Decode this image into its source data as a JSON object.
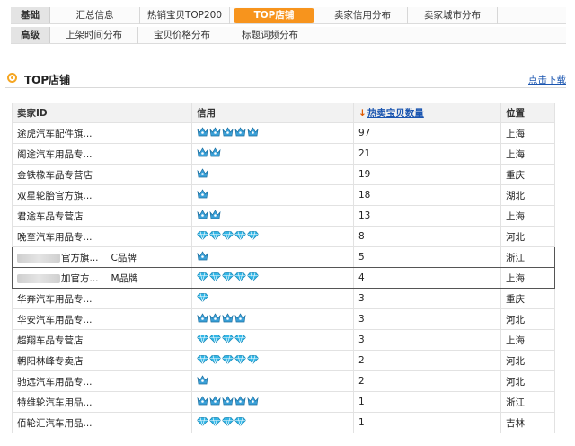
{
  "nav": {
    "row1": {
      "category": "基础",
      "tabs": [
        "汇总信息",
        "热销宝贝TOP200",
        "TOP店铺",
        "卖家信用分布",
        "卖家城市分布"
      ],
      "active_index": 2
    },
    "row2": {
      "category": "高级",
      "tabs": [
        "上架时间分布",
        "宝贝价格分布",
        "标题词频分布"
      ]
    }
  },
  "section": {
    "title": "TOP店铺",
    "download_label": "点击下载"
  },
  "table": {
    "headers": [
      "卖家ID",
      "信用",
      "热卖宝贝数量",
      "位置"
    ],
    "sort_arrow": "↓",
    "rows": [
      {
        "seller": "途虎汽车配件旗...",
        "brand": "",
        "credit_icon": "crown-icon",
        "credit_count": 5,
        "count": "97",
        "location": "上海"
      },
      {
        "seller": "阁途汽车用品专...",
        "brand": "",
        "credit_icon": "crown-icon",
        "credit_count": 2,
        "count": "21",
        "location": "上海"
      },
      {
        "seller": "金铁橡车品专营店",
        "brand": "",
        "credit_icon": "crown-icon",
        "credit_count": 1,
        "count": "19",
        "location": "重庆"
      },
      {
        "seller": "双星轮胎官方旗...",
        "brand": "",
        "credit_icon": "crown-icon",
        "credit_count": 1,
        "count": "18",
        "location": "湖北"
      },
      {
        "seller": "君途车品专营店",
        "brand": "",
        "credit_icon": "crown-icon",
        "credit_count": 2,
        "count": "13",
        "location": "上海"
      },
      {
        "seller": "晚奎汽车用品专...",
        "brand": "",
        "credit_icon": "diamond-icon",
        "credit_count": 5,
        "count": "8",
        "location": "河北"
      },
      {
        "seller": "官方旗...",
        "brand": "C品牌",
        "credit_icon": "crown-icon",
        "credit_count": 1,
        "count": "5",
        "location": "浙江",
        "blurred": true,
        "highlight": true
      },
      {
        "seller": "加官方...",
        "brand": "M品牌",
        "credit_icon": "diamond-icon",
        "credit_count": 5,
        "count": "4",
        "location": "上海",
        "blurred": true,
        "highlight": true
      },
      {
        "seller": "华奔汽车用品专...",
        "brand": "",
        "credit_icon": "diamond-icon",
        "credit_count": 1,
        "count": "3",
        "location": "重庆"
      },
      {
        "seller": "华安汽车用品专...",
        "brand": "",
        "credit_icon": "crown-icon",
        "credit_count": 4,
        "count": "3",
        "location": "河北"
      },
      {
        "seller": "超翔车品专营店",
        "brand": "",
        "credit_icon": "diamond-icon",
        "credit_count": 4,
        "count": "3",
        "location": "上海"
      },
      {
        "seller": "朝阳林峰专卖店",
        "brand": "",
        "credit_icon": "diamond-icon",
        "credit_count": 5,
        "count": "2",
        "location": "河北"
      },
      {
        "seller": "驰远汽车用品专...",
        "brand": "",
        "credit_icon": "crown-icon",
        "credit_count": 1,
        "count": "2",
        "location": "河北"
      },
      {
        "seller": "特维轮汽车用品...",
        "brand": "",
        "credit_icon": "crown-icon",
        "credit_count": 5,
        "count": "1",
        "location": "浙江"
      },
      {
        "seller": "佰轮汇汽车用品...",
        "brand": "",
        "credit_icon": "diamond-icon",
        "credit_count": 4,
        "count": "1",
        "location": "吉林"
      }
    ]
  },
  "colors": {
    "active_tab": "#f7941d",
    "link": "#1a55b0",
    "crown": "#3aa0d8",
    "diamond": "#33b6e6"
  }
}
